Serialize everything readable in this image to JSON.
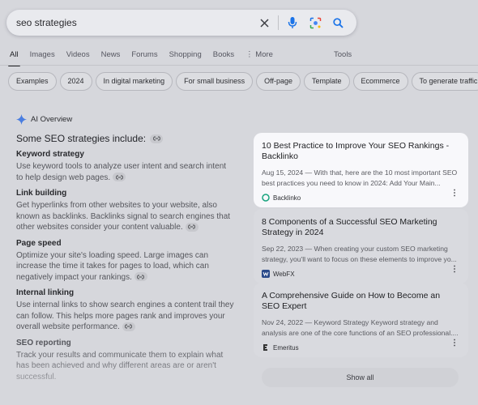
{
  "search": {
    "query": "seo strategies"
  },
  "tabs": [
    {
      "label": "All"
    },
    {
      "label": "Images"
    },
    {
      "label": "Videos"
    },
    {
      "label": "News"
    },
    {
      "label": "Forums"
    },
    {
      "label": "Shopping"
    },
    {
      "label": "Books"
    },
    {
      "label": "⋮ More"
    }
  ],
  "tools_label": "Tools",
  "chips": [
    "Examples",
    "2024",
    "In digital marketing",
    "For small business",
    "Off-page",
    "Template",
    "Ecommerce",
    "To generate traffic"
  ],
  "ai_overview": {
    "label": "AI Overview",
    "intro": "Some SEO strategies include:",
    "sections": [
      {
        "title": "Keyword strategy",
        "body": "Use keyword tools to analyze user intent and search intent to help design web pages."
      },
      {
        "title": "Link building",
        "body": "Get hyperlinks from other websites to your website, also known as backlinks. Backlinks signal to search engines that other websites consider your content valuable."
      },
      {
        "title": "Page speed",
        "body": "Optimize your site's loading speed. Large images can increase the time it takes for pages to load, which can negatively impact your rankings."
      },
      {
        "title": "Internal linking",
        "body": "Use internal links to show search engines a content trail they can follow. This helps more pages rank and improves your overall website performance."
      },
      {
        "title": "SEO reporting",
        "body": "Track your results and communicate them to explain what has been achieved and why different areas are or aren't successful."
      }
    ]
  },
  "sources": [
    {
      "title": "10 Best Practice to Improve Your SEO Rankings - Backlinko",
      "snippet": "Aug 15, 2024 — With that, here are the 10 most important SEO best practices you need to know in 2024: Add Your Main...",
      "source": "Backlinko",
      "icon_color": "#18a47e"
    },
    {
      "title": "8 Components of a Successful SEO Marketing Strategy in 2024",
      "snippet": "Sep 22, 2023 — When creating your custom SEO marketing strategy, you'll want to focus on these elements to improve yo...",
      "source": "WebFX",
      "icon_color": "#2a4a8a"
    },
    {
      "title": "A Comprehensive Guide on How to Become an SEO Expert",
      "snippet": "Nov 24, 2022 — Keyword Strategy Keyword strategy and analysis are one of the core functions of an SEO professional....",
      "source": "Emeritus",
      "icon_color": "#333333"
    }
  ],
  "show_all_label": "Show all",
  "colors": {
    "blue": "#1a73e8",
    "highlight_bg": "#f8f8fb"
  }
}
